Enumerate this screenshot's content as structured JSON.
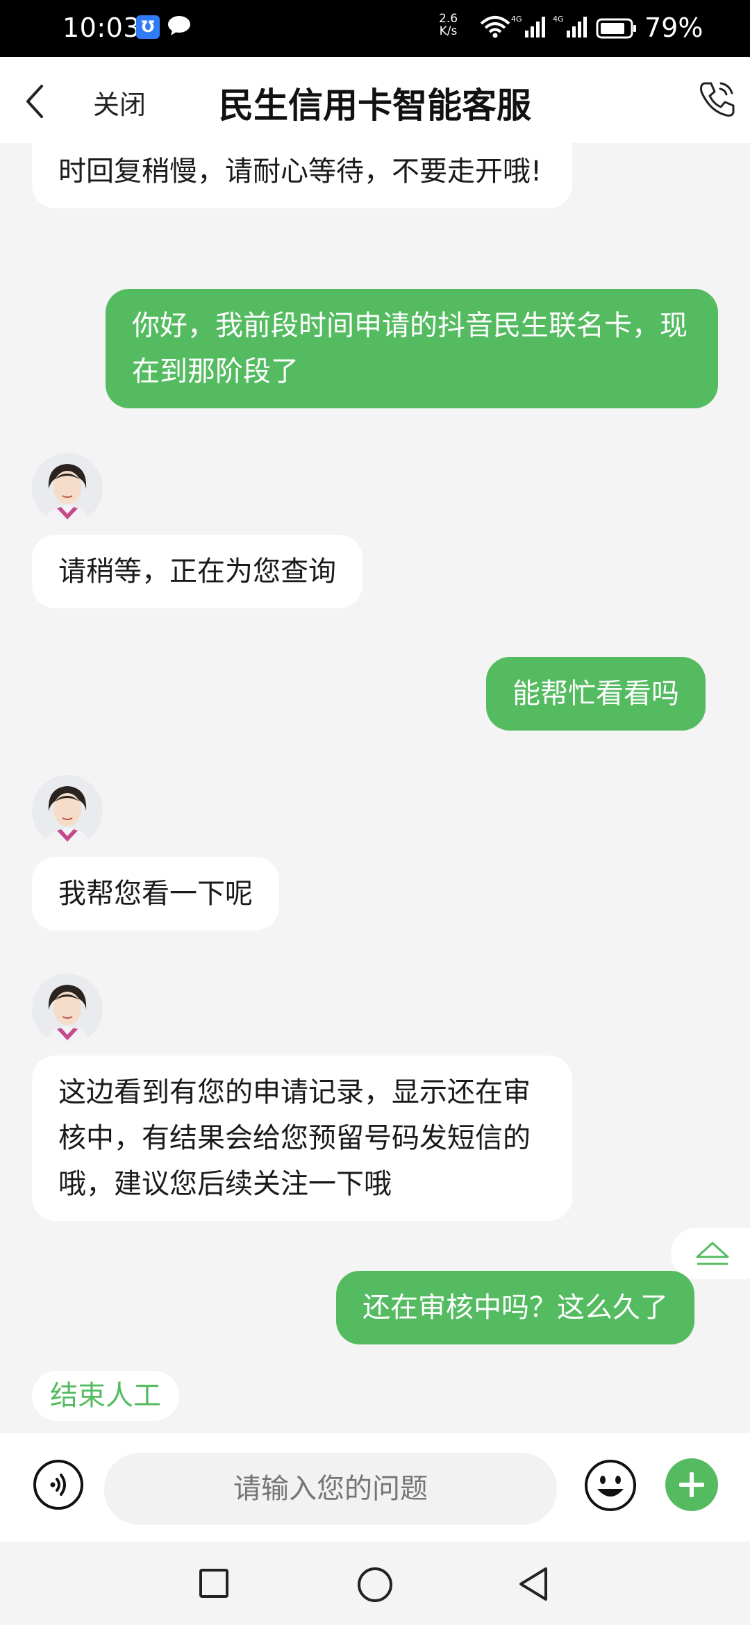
{
  "status_bar": {
    "time": "10:03",
    "net_speed_top": "2.6",
    "net_speed_bottom": "K/s",
    "battery": "79%",
    "signal1_label": "4G",
    "signal2_label": "4G"
  },
  "header": {
    "close_label": "关闭",
    "title": "民生信用卡智能客服"
  },
  "messages": [
    {
      "from": "agent",
      "text": "时回复稍慢，请耐心等待，不要走开哦!"
    },
    {
      "from": "user",
      "text": "你好，我前段时间申请的抖音民生联名卡，现在到那阶段了"
    },
    {
      "from": "agent",
      "text": "请稍等，正在为您查询"
    },
    {
      "from": "user",
      "text": "能帮忙看看吗"
    },
    {
      "from": "agent",
      "text": "我帮您看一下呢"
    },
    {
      "from": "agent",
      "text": "这边看到有您的申请记录，显示还在审核中，有结果会给您预留号码发短信的哦，建议您后续关注一下哦"
    },
    {
      "from": "user",
      "text": "还在审核中吗？这么久了"
    }
  ],
  "end_service_label": "结束人工",
  "input": {
    "placeholder": "请输入您的问题"
  },
  "colors": {
    "accent_green": "#55bb61",
    "background": "#f4f4f4"
  }
}
